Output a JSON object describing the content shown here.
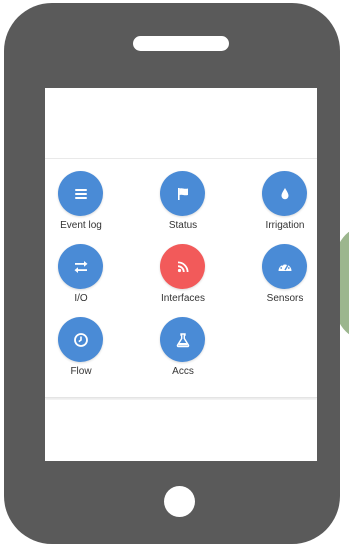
{
  "colors": {
    "phone_body": "#5a5a5a",
    "tile_blue": "#4a8bd6",
    "tile_red": "#f25a5a",
    "label_text": "#333333"
  },
  "menu": {
    "tiles": [
      {
        "label": "Event log",
        "icon": "list-icon",
        "color": "#4a8bd6"
      },
      {
        "label": "Status",
        "icon": "flag-icon",
        "color": "#4a8bd6"
      },
      {
        "label": "Irrigation",
        "icon": "water-drop-icon",
        "color": "#4a8bd6"
      },
      {
        "label": "I/O",
        "icon": "swap-arrows-icon",
        "color": "#4a8bd6"
      },
      {
        "label": "Interfaces",
        "icon": "rss-signal-icon",
        "color": "#f25a5a"
      },
      {
        "label": "Sensors",
        "icon": "gauge-icon",
        "color": "#4a8bd6"
      },
      {
        "label": "Flow",
        "icon": "clock-icon",
        "color": "#4a8bd6"
      },
      {
        "label": "Accs",
        "icon": "flask-icon",
        "color": "#4a8bd6"
      }
    ]
  }
}
